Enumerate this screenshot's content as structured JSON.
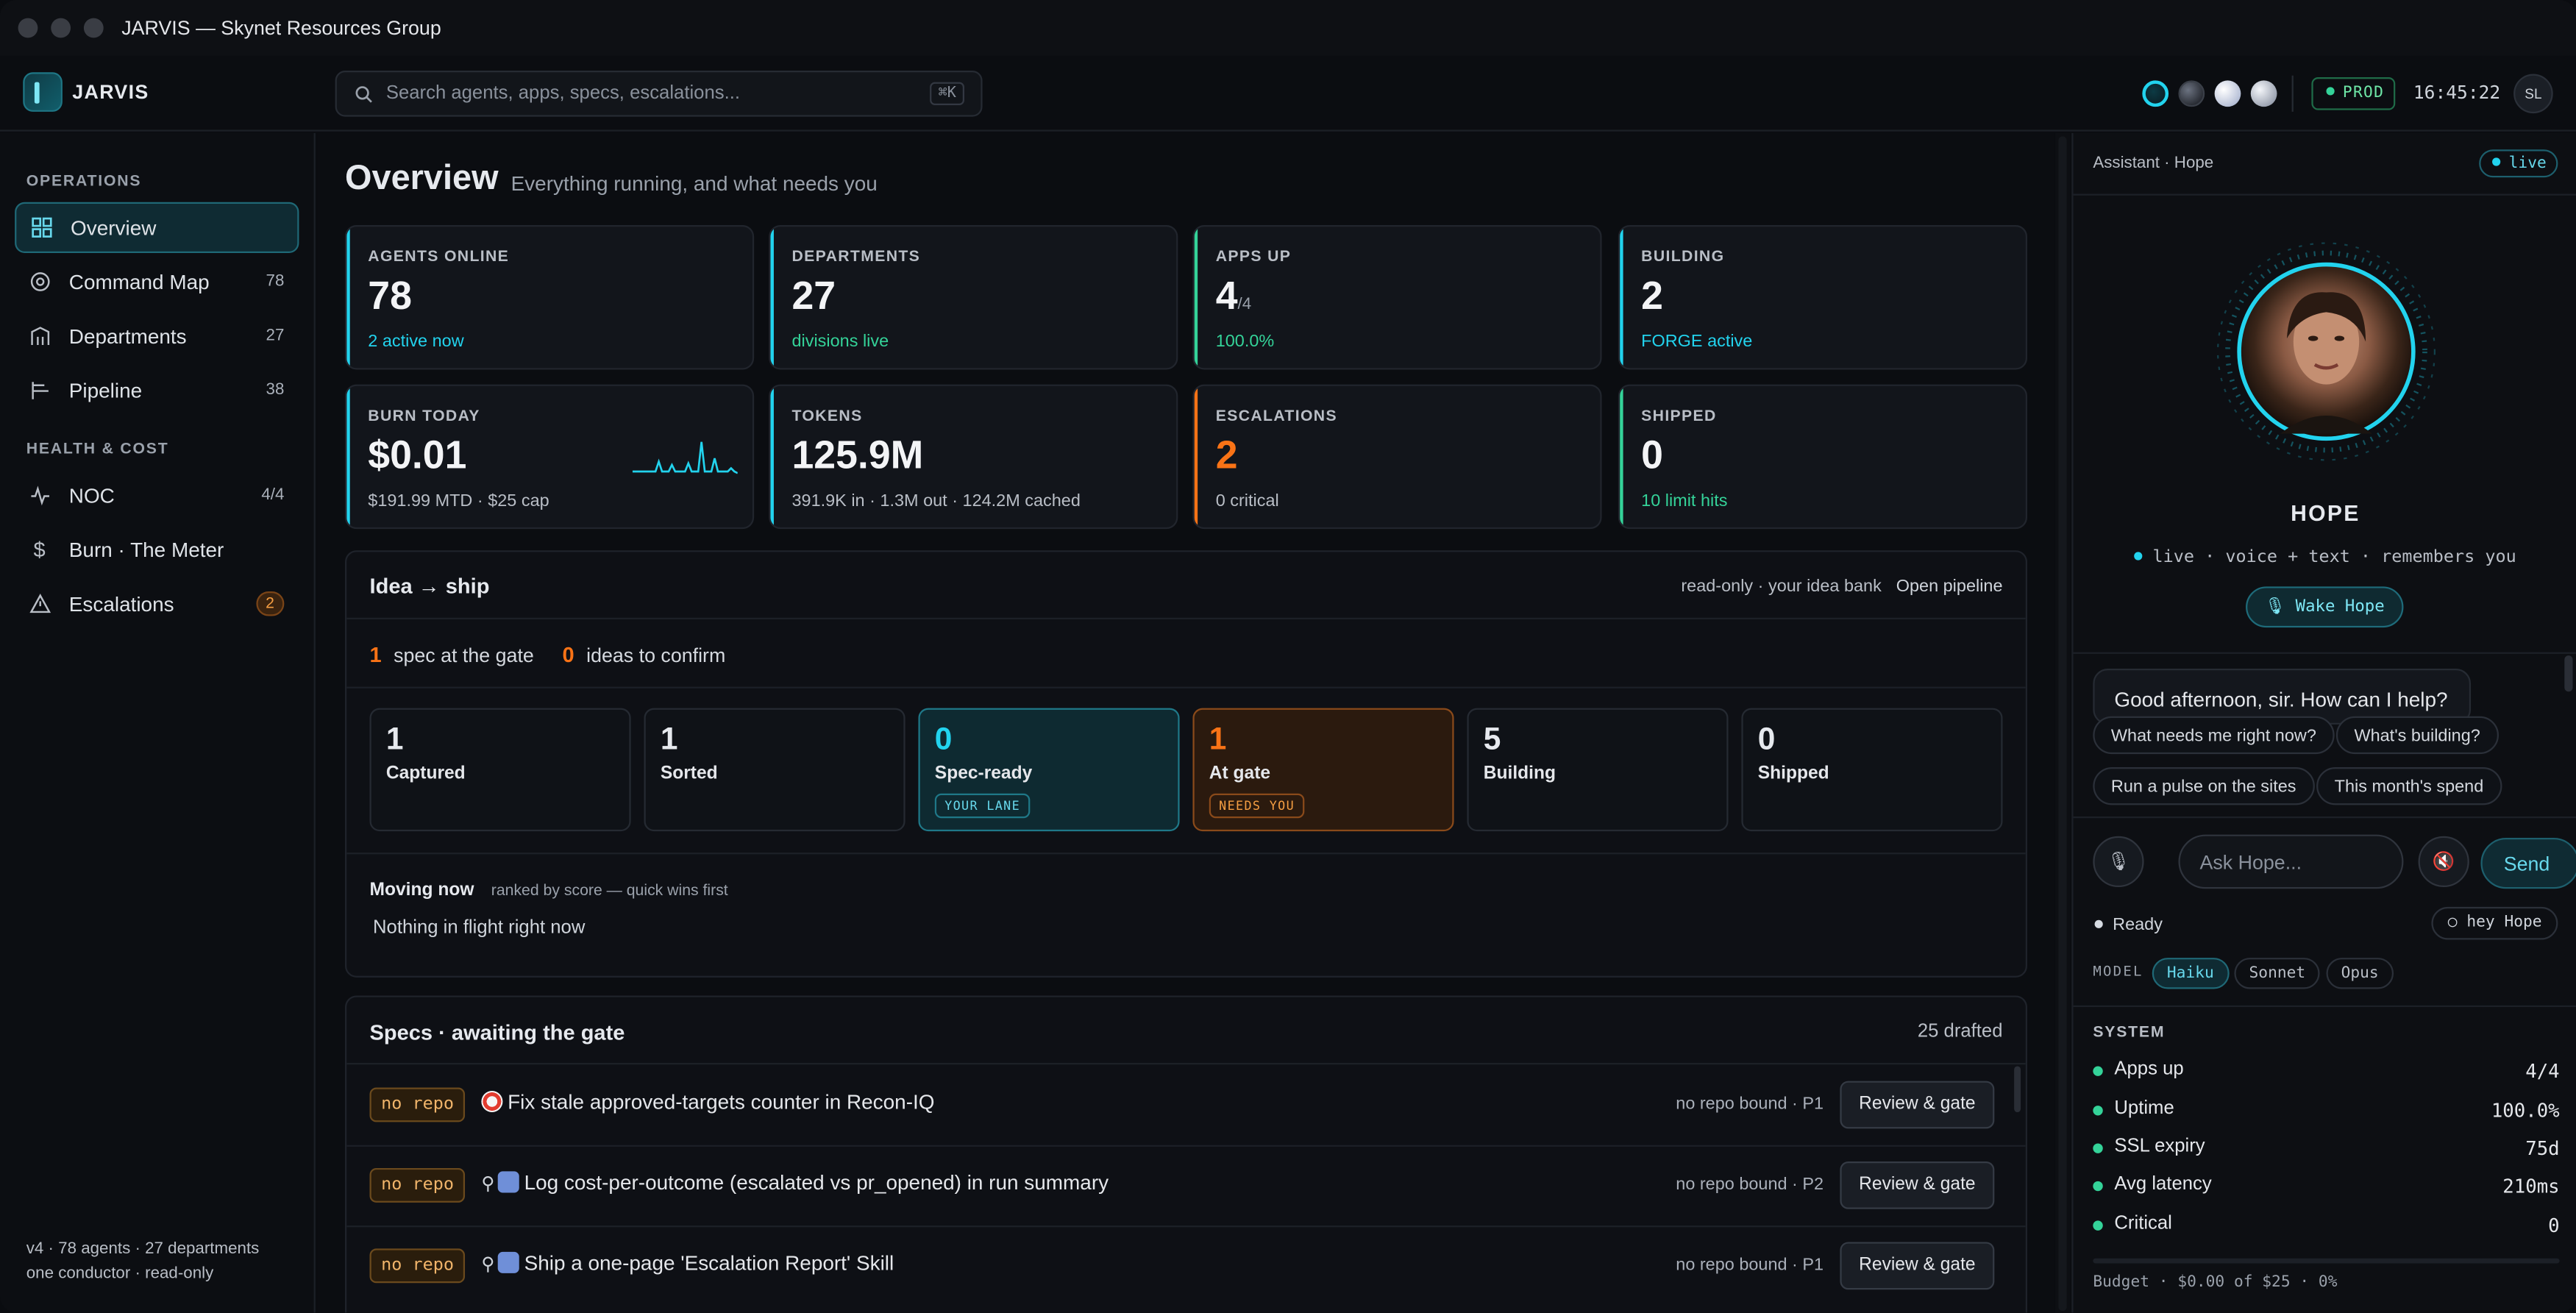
{
  "window": {
    "title": "JARVIS — Skynet Resources Group"
  },
  "header": {
    "brand": "JARVIS",
    "search_placeholder": "Search agents, apps, specs, escalations...",
    "search_shortcut": "⌘K",
    "env": "PROD",
    "clock": "16:45:22",
    "user_initials": "SL"
  },
  "sidebar": {
    "sections": [
      "OPERATIONS",
      "HEALTH & COST"
    ],
    "items": [
      {
        "label": "Overview",
        "count": "",
        "icon": "grid-icon",
        "active": true
      },
      {
        "label": "Command Map",
        "count": "78",
        "icon": "target-icon"
      },
      {
        "label": "Departments",
        "count": "27",
        "icon": "building-icon"
      },
      {
        "label": "Pipeline",
        "count": "38",
        "icon": "pipeline-icon"
      },
      {
        "label": "NOC",
        "count": "4/4",
        "icon": "pulse-icon"
      },
      {
        "label": "Burn · The Meter",
        "count": "",
        "icon": "dollar-icon"
      },
      {
        "label": "Escalations",
        "count": "2",
        "icon": "warning-icon"
      }
    ],
    "footer_line1": "v4 · 78 agents · 27 departments",
    "footer_line2": "one conductor · read-only"
  },
  "overview": {
    "title": "Overview",
    "subtitle": "Everything running, and what needs you",
    "cards": [
      {
        "label": "AGENTS ONLINE",
        "value": "78",
        "suffix": "",
        "sub": "2 active now",
        "accent": "#22d3ee"
      },
      {
        "label": "DEPARTMENTS",
        "value": "27",
        "suffix": "",
        "sub": "divisions live",
        "accent": "#22d3ee"
      },
      {
        "label": "APPS UP",
        "value": "4",
        "suffix": "/4",
        "sub": "100.0%",
        "accent": "#34d399"
      },
      {
        "label": "BUILDING",
        "value": "2",
        "suffix": "",
        "sub": "FORGE active",
        "accent": "#22d3ee"
      },
      {
        "label": "BURN TODAY",
        "value": "$0.01",
        "suffix": "",
        "sub": "$191.99 MTD · $25 cap",
        "accent": "#22d3ee"
      },
      {
        "label": "TOKENS",
        "value": "125.9M",
        "suffix": "",
        "sub": "391.9K in · 1.3M out · 124.2M cached",
        "accent": "#22d3ee"
      },
      {
        "label": "ESCALATIONS",
        "value": "2",
        "suffix": "",
        "sub": "0 critical",
        "accent": "#f97316"
      },
      {
        "label": "SHIPPED",
        "value": "0",
        "suffix": "",
        "sub": "10 limit hits",
        "accent": "#34d399"
      }
    ]
  },
  "idea_panel": {
    "title": "Idea → ship",
    "note": "read-only · your idea bank",
    "link": "Open pipeline",
    "gate_count": "1",
    "gate_text": "spec at the gate",
    "confirm_count": "0",
    "confirm_text": "ideas to confirm",
    "stages": [
      {
        "count": "1",
        "label": "Captured",
        "tag": ""
      },
      {
        "count": "1",
        "label": "Sorted",
        "tag": ""
      },
      {
        "count": "0",
        "label": "Spec-ready",
        "tag": "YOUR LANE"
      },
      {
        "count": "1",
        "label": "At gate",
        "tag": "NEEDS YOU"
      },
      {
        "count": "5",
        "label": "Building",
        "tag": ""
      },
      {
        "count": "0",
        "label": "Shipped",
        "tag": ""
      }
    ],
    "moving_title": "Moving now",
    "moving_note": "ranked by score — quick wins first",
    "moving_empty": "Nothing in flight right now"
  },
  "specs_panel": {
    "title": "Specs · awaiting the gate",
    "drafted": "25 drafted",
    "rows": [
      {
        "repo": "no repo",
        "title": "Fix stale approved-targets counter in Recon-IQ",
        "meta": "no repo bound · P1",
        "button": "Review & gate"
      },
      {
        "repo": "no repo",
        "title": "Log cost-per-outcome (escalated vs pr_opened) in run summary",
        "meta": "no repo bound · P2",
        "button": "Review & gate"
      },
      {
        "repo": "no repo",
        "title": "Ship a one-page 'Escalation Report' Skill",
        "meta": "no repo bound · P1",
        "button": "Review & gate"
      }
    ]
  },
  "assistant": {
    "header": "Assistant · Hope",
    "live": "live",
    "name": "HOPE",
    "status": "live · voice + text · remembers you",
    "wake": "Wake Hope",
    "greeting": "Good afternoon, sir. How can I help?",
    "chips": [
      "What needs me right now?",
      "What's building?",
      "Run a pulse on the sites",
      "This month's spend"
    ],
    "input_placeholder": "Ask Hope...",
    "send": "Send",
    "ready": "Ready",
    "wakeword": "hey Hope",
    "model_label": "MODEL",
    "models": [
      "Haiku",
      "Sonnet",
      "Opus"
    ],
    "system_label": "SYSTEM",
    "system": [
      {
        "k": "Apps up",
        "v": "4/4"
      },
      {
        "k": "Uptime",
        "v": "100.0%"
      },
      {
        "k": "SSL expiry",
        "v": "75d"
      },
      {
        "k": "Avg latency",
        "v": "210ms"
      },
      {
        "k": "Critical",
        "v": "0"
      }
    ],
    "budget": "Budget · $0.00 of $25 · 0%"
  }
}
